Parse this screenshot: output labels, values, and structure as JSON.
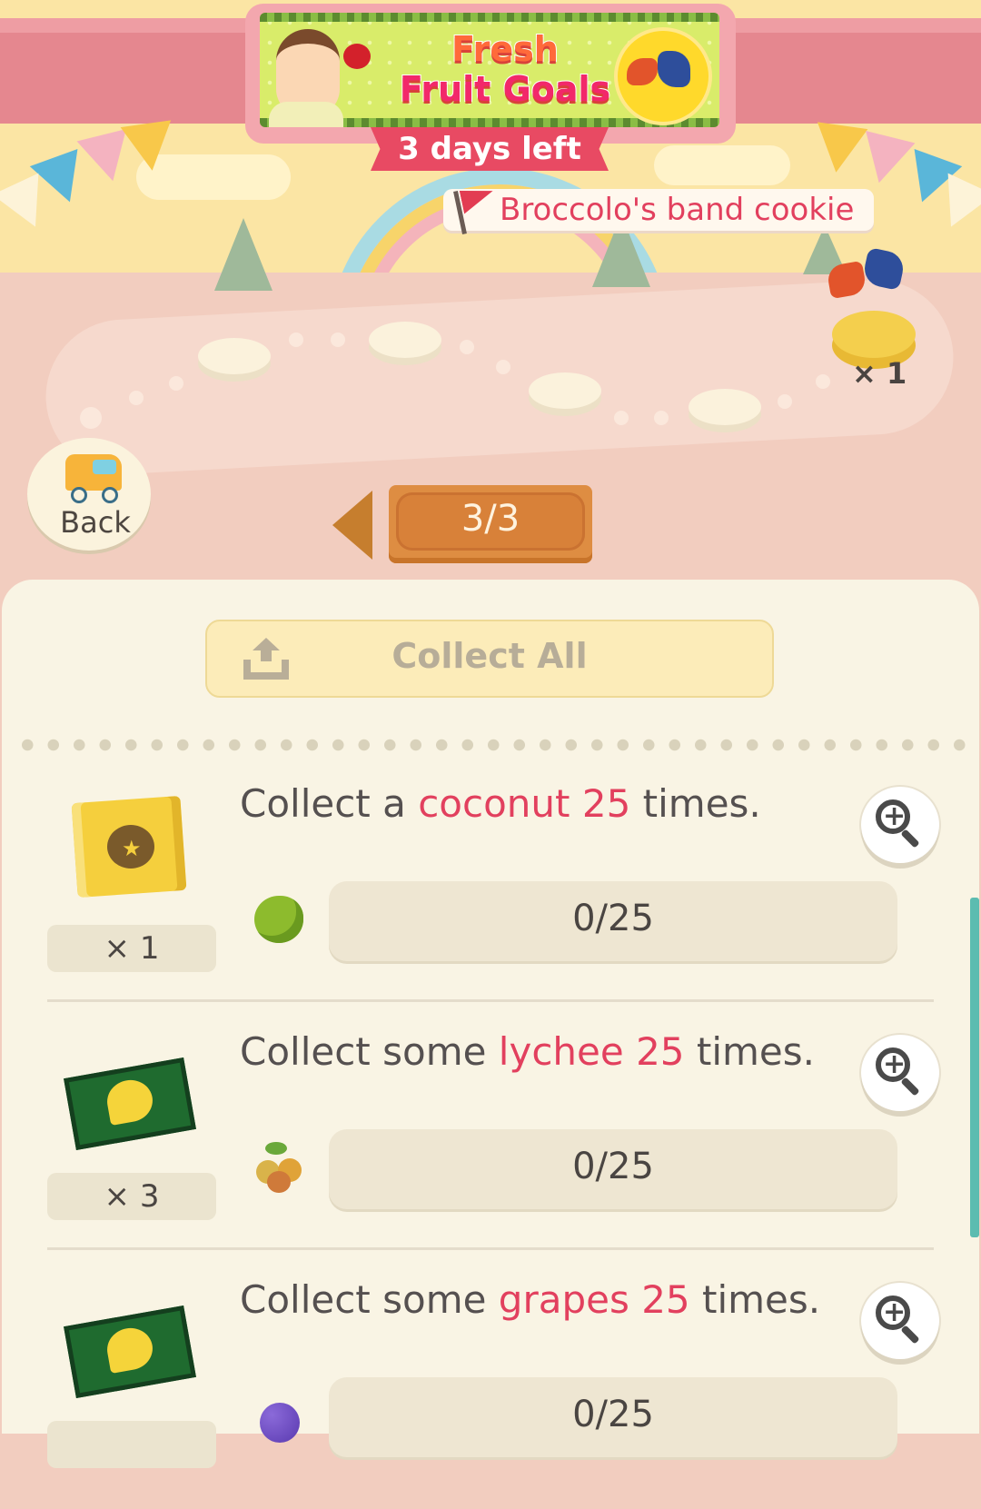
{
  "event": {
    "title_line1": "Fresh",
    "title_line2": "Fruit Goals",
    "days_left": "3 days left",
    "goal_reward": "Broccolo's band cookie",
    "goal_reward_count": "× 1"
  },
  "nav": {
    "back_label": "Back",
    "page_indicator": "3/3"
  },
  "collect_all_label": "Collect All",
  "tasks": [
    {
      "text_before": "Collect a ",
      "item": "coconut",
      "amount": "25",
      "text_after": " times.",
      "reward_icon": "gold-map-icon",
      "reward_count": "× 1",
      "fruit_icon": "coconut-icon",
      "progress": "0/25",
      "progress_fraction": 0
    },
    {
      "text_before": "Collect some ",
      "item": "lychee",
      "amount": "25",
      "text_after": " times.",
      "reward_icon": "leaf-ticket-icon",
      "reward_count": "× 3",
      "fruit_icon": "lychee-icon",
      "progress": "0/25",
      "progress_fraction": 0
    },
    {
      "text_before": "Collect some ",
      "item": "grapes",
      "amount": "25",
      "text_after": " times.",
      "reward_icon": "leaf-ticket-icon",
      "reward_count": "",
      "fruit_icon": "grapes-icon",
      "progress": "0/25",
      "progress_fraction": 0
    }
  ],
  "colors": {
    "highlight": "#e2405e",
    "panel": "#f9f4e4",
    "collect_button": "#fcecb9",
    "page_plate": "#de8d42",
    "scrollbar": "#5cbcb0"
  }
}
